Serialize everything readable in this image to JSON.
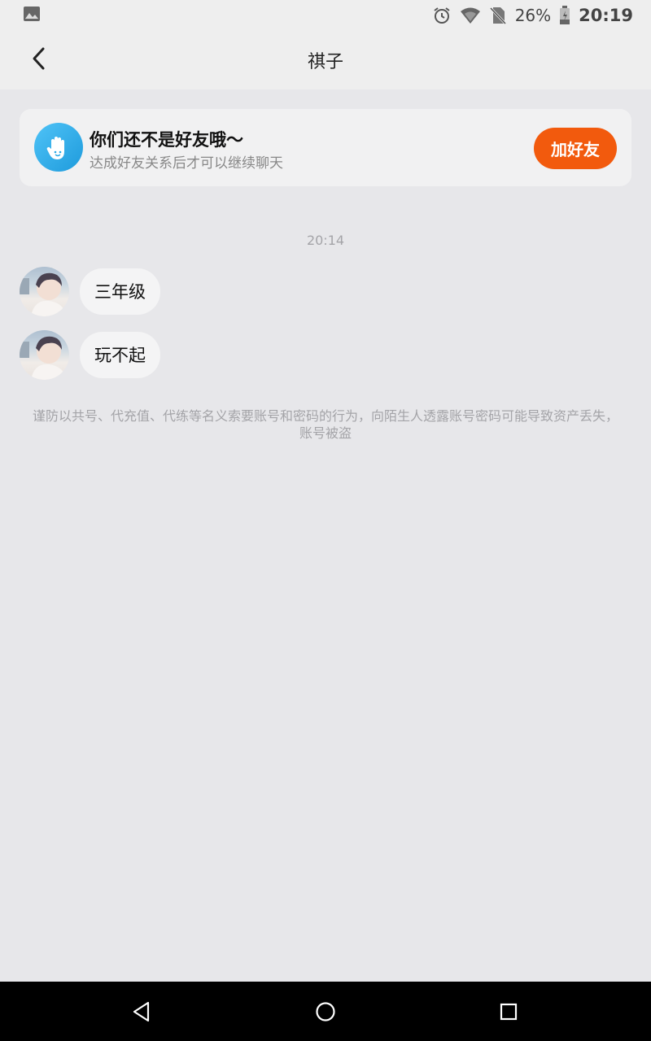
{
  "status_bar": {
    "battery": "26%",
    "time": "20:19",
    "icons": [
      "image-icon",
      "alarm-icon",
      "wifi-icon",
      "no-sim-icon",
      "battery-icon"
    ]
  },
  "header": {
    "title": "祺子",
    "back_icon": "back-arrow-icon"
  },
  "friend_banner": {
    "title": "你们还不是好友哦～",
    "subtitle": "达成好友关系后才可以继续聊天",
    "button_label": "加好友",
    "icon": "hand-wave-icon",
    "colors": {
      "button": "#f25a0d",
      "icon_bg": "#29a9e6"
    }
  },
  "chat": {
    "timestamp": "20:14",
    "messages": [
      {
        "text": "三年级"
      },
      {
        "text": "玩不起"
      }
    ],
    "notice": "谨防以共号、代充值、代练等名义索要账号和密码的行为，向陌生人透露账号密码可能导致资产丢失，账号被盗"
  },
  "nav_bar": {
    "icons": [
      "nav-back-icon",
      "nav-home-icon",
      "nav-recents-icon"
    ]
  }
}
